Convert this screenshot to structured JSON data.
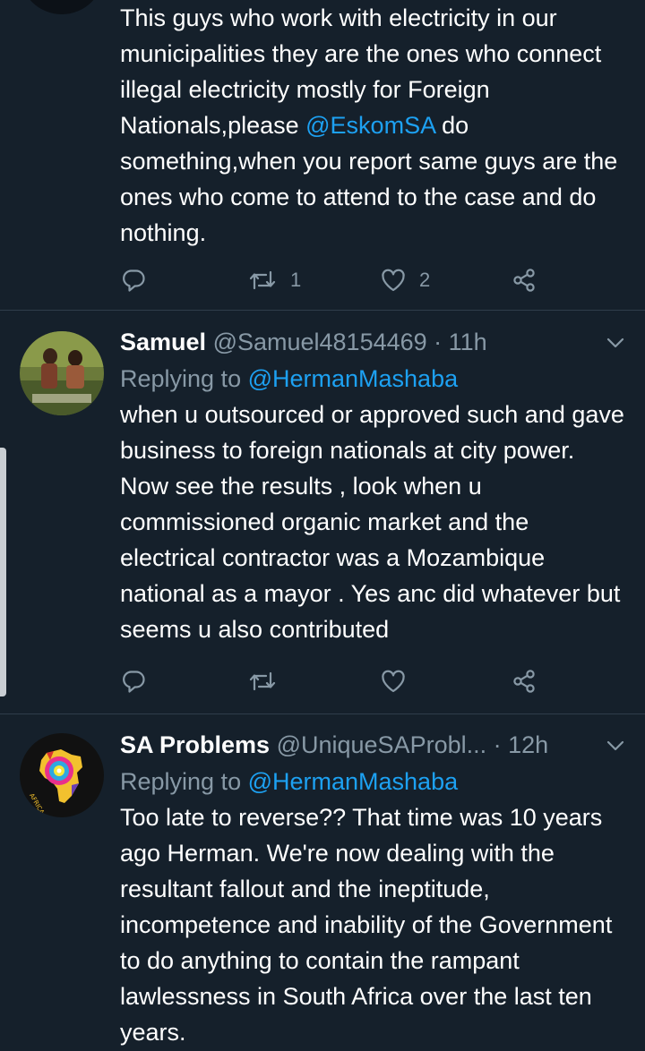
{
  "colors": {
    "background": "#15202b",
    "text_primary": "#ffffff",
    "text_secondary": "#8899a6",
    "accent": "#1da1f2",
    "divider": "#2f3d4a"
  },
  "tweets": [
    {
      "text_before_mention": "This guys who work with electricity in our municipalities they are the ones who connect illegal electricity mostly for Foreign Nationals,please ",
      "mention": "@EskomSA",
      "text_after_mention": " do something,when you report same guys are the ones who come to attend to the case and do nothing.",
      "actions": {
        "replies": "",
        "retweets": "1",
        "likes": "2"
      }
    },
    {
      "display_name": "Samuel",
      "handle": "@Samuel48154469",
      "separator": " · ",
      "time": "11h",
      "replying_label": "Replying to ",
      "replying_to": "@HermanMashaba",
      "text": "when u outsourced or approved such and gave business to foreign nationals at city power. Now see the results , look when u commissioned organic market and the electrical contractor was a Mozambique national as a mayor . Yes anc did whatever but seems u also contributed",
      "actions": {
        "replies": "",
        "retweets": "",
        "likes": ""
      }
    },
    {
      "display_name": "SA Problems",
      "handle": "@UniqueSAProbl...",
      "separator": " · ",
      "time": "12h",
      "replying_label": "Replying to ",
      "replying_to": "@HermanMashaba",
      "text": "Too late to reverse?? That time was 10 years ago Herman. We're now dealing with the resultant fallout and the ineptitude, incompetence and inability of the Government to do anything to contain the rampant lawlessness in South Africa over the last ten years.",
      "avatar_text": "AFRICA"
    }
  ],
  "icons": [
    "reply-icon",
    "retweet-icon",
    "like-icon",
    "share-icon",
    "chevron-down-icon"
  ]
}
